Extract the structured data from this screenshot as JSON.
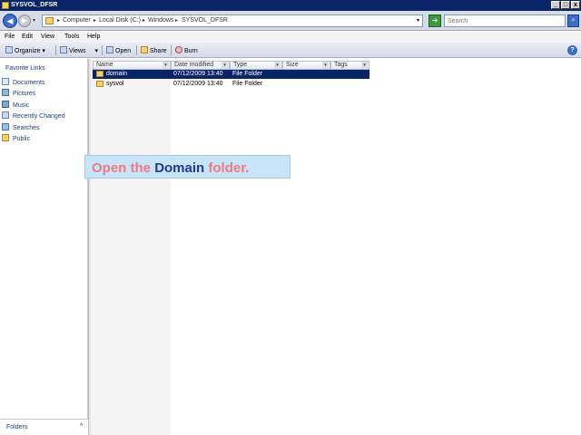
{
  "window": {
    "title": "SYSVOL_DFSR",
    "controls": {
      "minimize": "_",
      "maximize": "□",
      "close": "x"
    }
  },
  "address": {
    "back_glyph": "◀",
    "forward_glyph": "▶",
    "breadcrumbs": [
      "Computer",
      "Local Disk (C:)",
      "Windows",
      "SYSVOL_DFSR"
    ],
    "separator": "▸",
    "refresh_glyph": "➔",
    "search_placeholder": "Search",
    "search_go_glyph": "⌕"
  },
  "menu": {
    "items": [
      "File",
      "Edit",
      "View",
      "Tools",
      "Help"
    ]
  },
  "toolbar": {
    "organize": "Organize",
    "views": "Views",
    "explore": "Open",
    "share": "Share",
    "burn": "Burn",
    "dropdown_glyph": "▾",
    "help_glyph": "?"
  },
  "navigation": {
    "title": "Favorite Links",
    "links": [
      "Documents",
      "Pictures",
      "Music",
      "Recently Changed",
      "Searches",
      "Public"
    ],
    "folders_label": "Folders",
    "folders_chevron": "^"
  },
  "file_list": {
    "columns": [
      "Name",
      "Date modified",
      "Type",
      "Size",
      "Tags"
    ],
    "rows": [
      {
        "name": "domain",
        "date": "07/12/2009 13:40",
        "type": "File Folder",
        "size": "",
        "selected": true
      },
      {
        "name": "sysvol",
        "date": "07/12/2009 13:40",
        "type": "File Folder",
        "size": "",
        "selected": false
      }
    ]
  },
  "instruction": {
    "prefix": "Open the",
    "target": "Domain",
    "suffix": "folder."
  },
  "colors": {
    "title_bar": "#0a246a",
    "selection": "#0a246a",
    "callout_bg": "#c8e4f8",
    "callout_text": "#ee7a82",
    "callout_target": "#22389a"
  },
  "icons": {
    "back": "back-arrow-icon",
    "forward": "forward-arrow-icon",
    "refresh": "refresh-icon",
    "search": "search-icon",
    "help": "help-icon",
    "folder": "folder-icon"
  }
}
